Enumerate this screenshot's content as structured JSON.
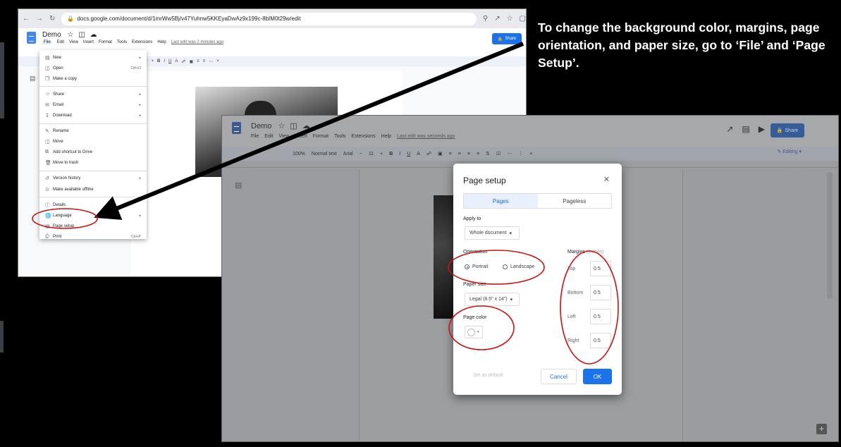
{
  "instruction": "To change the background color, margins, page orientation, and paper size, go to ‘File’ and ‘Page Setup’.",
  "colors": {
    "annotation_red": "#d01010",
    "arrow": "#000000",
    "accent_blue": "#1a73e8"
  },
  "shot1": {
    "url": "docs.google.com/document/d/1mrWw5Bj/v47Yuhnw5KKEyaDwAz9x199c-8bIM0t29w/edit",
    "doc_title": "Demo",
    "menu": [
      "File",
      "Edit",
      "View",
      "Insert",
      "Format",
      "Tools",
      "Extensions",
      "Help"
    ],
    "last_edit": "Last edit was 2 minutes ago",
    "share": "Share",
    "file_menu": {
      "new": "New",
      "open": "Open",
      "open_shortcut": "Ctrl+O",
      "make_copy": "Make a copy",
      "share": "Share",
      "email": "Email",
      "download": "Download",
      "rename": "Rename",
      "move": "Move",
      "add_shortcut": "Add shortcut to Drive",
      "move_trash": "Move to trash",
      "version_history": "Version history",
      "make_offline": "Make available offline",
      "details": "Details",
      "language": "Language",
      "page_setup": "Page setup",
      "print": "Print",
      "print_shortcut": "Ctrl+P"
    }
  },
  "shot2": {
    "doc_title": "Demo",
    "menu": [
      "File",
      "Edit",
      "View",
      "Insert",
      "Format",
      "Tools",
      "Extensions",
      "Help"
    ],
    "last_edit": "Last edit was seconds ago",
    "share": "Share",
    "editing": "Editing",
    "zoom": "100%",
    "style": "Normal text",
    "font": "Arial",
    "font_size": "11"
  },
  "dialog": {
    "title": "Page setup",
    "tabs": [
      "Pages",
      "Pageless"
    ],
    "apply_to_label": "Apply to",
    "apply_to_value": "Whole document",
    "orientation_label": "Orientation",
    "portrait": "Portrait",
    "landscape": "Landscape",
    "paper_size_label": "Paper size",
    "paper_size_value": "Legal (8.5\" x 14\")",
    "page_color_label": "Page color",
    "margins_label": "Margins",
    "margins_unit": "(inches)",
    "margins": {
      "top_label": "Top",
      "top": "0.5",
      "bottom_label": "Bottom",
      "bottom": "0.5",
      "left_label": "Left",
      "left": "0.5",
      "right_label": "Right",
      "right": "0.5"
    },
    "set_default": "Set as default",
    "cancel": "Cancel",
    "ok": "OK"
  }
}
